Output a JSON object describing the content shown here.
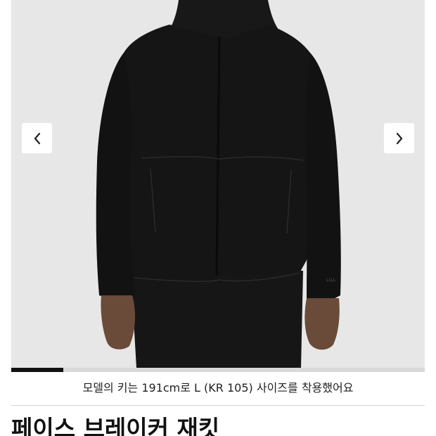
{
  "gallery": {
    "image_subject": "Black hooded zip jacket worn by a model",
    "jacket_logo_text": "LLLL",
    "prev_icon": "chevron-left-icon",
    "next_icon": "chevron-right-icon",
    "progress_fraction": 0.125
  },
  "model_note": "모델의 키는 191cm로 L (KR 105) 사이즈를 착용했어요",
  "product": {
    "title": "페이스 브레이커 재킷"
  },
  "colors": {
    "photo_background": "#e7e7e7",
    "jacket": "#151515",
    "progress_active": "#111111",
    "progress_track": "#d9d9d9"
  }
}
